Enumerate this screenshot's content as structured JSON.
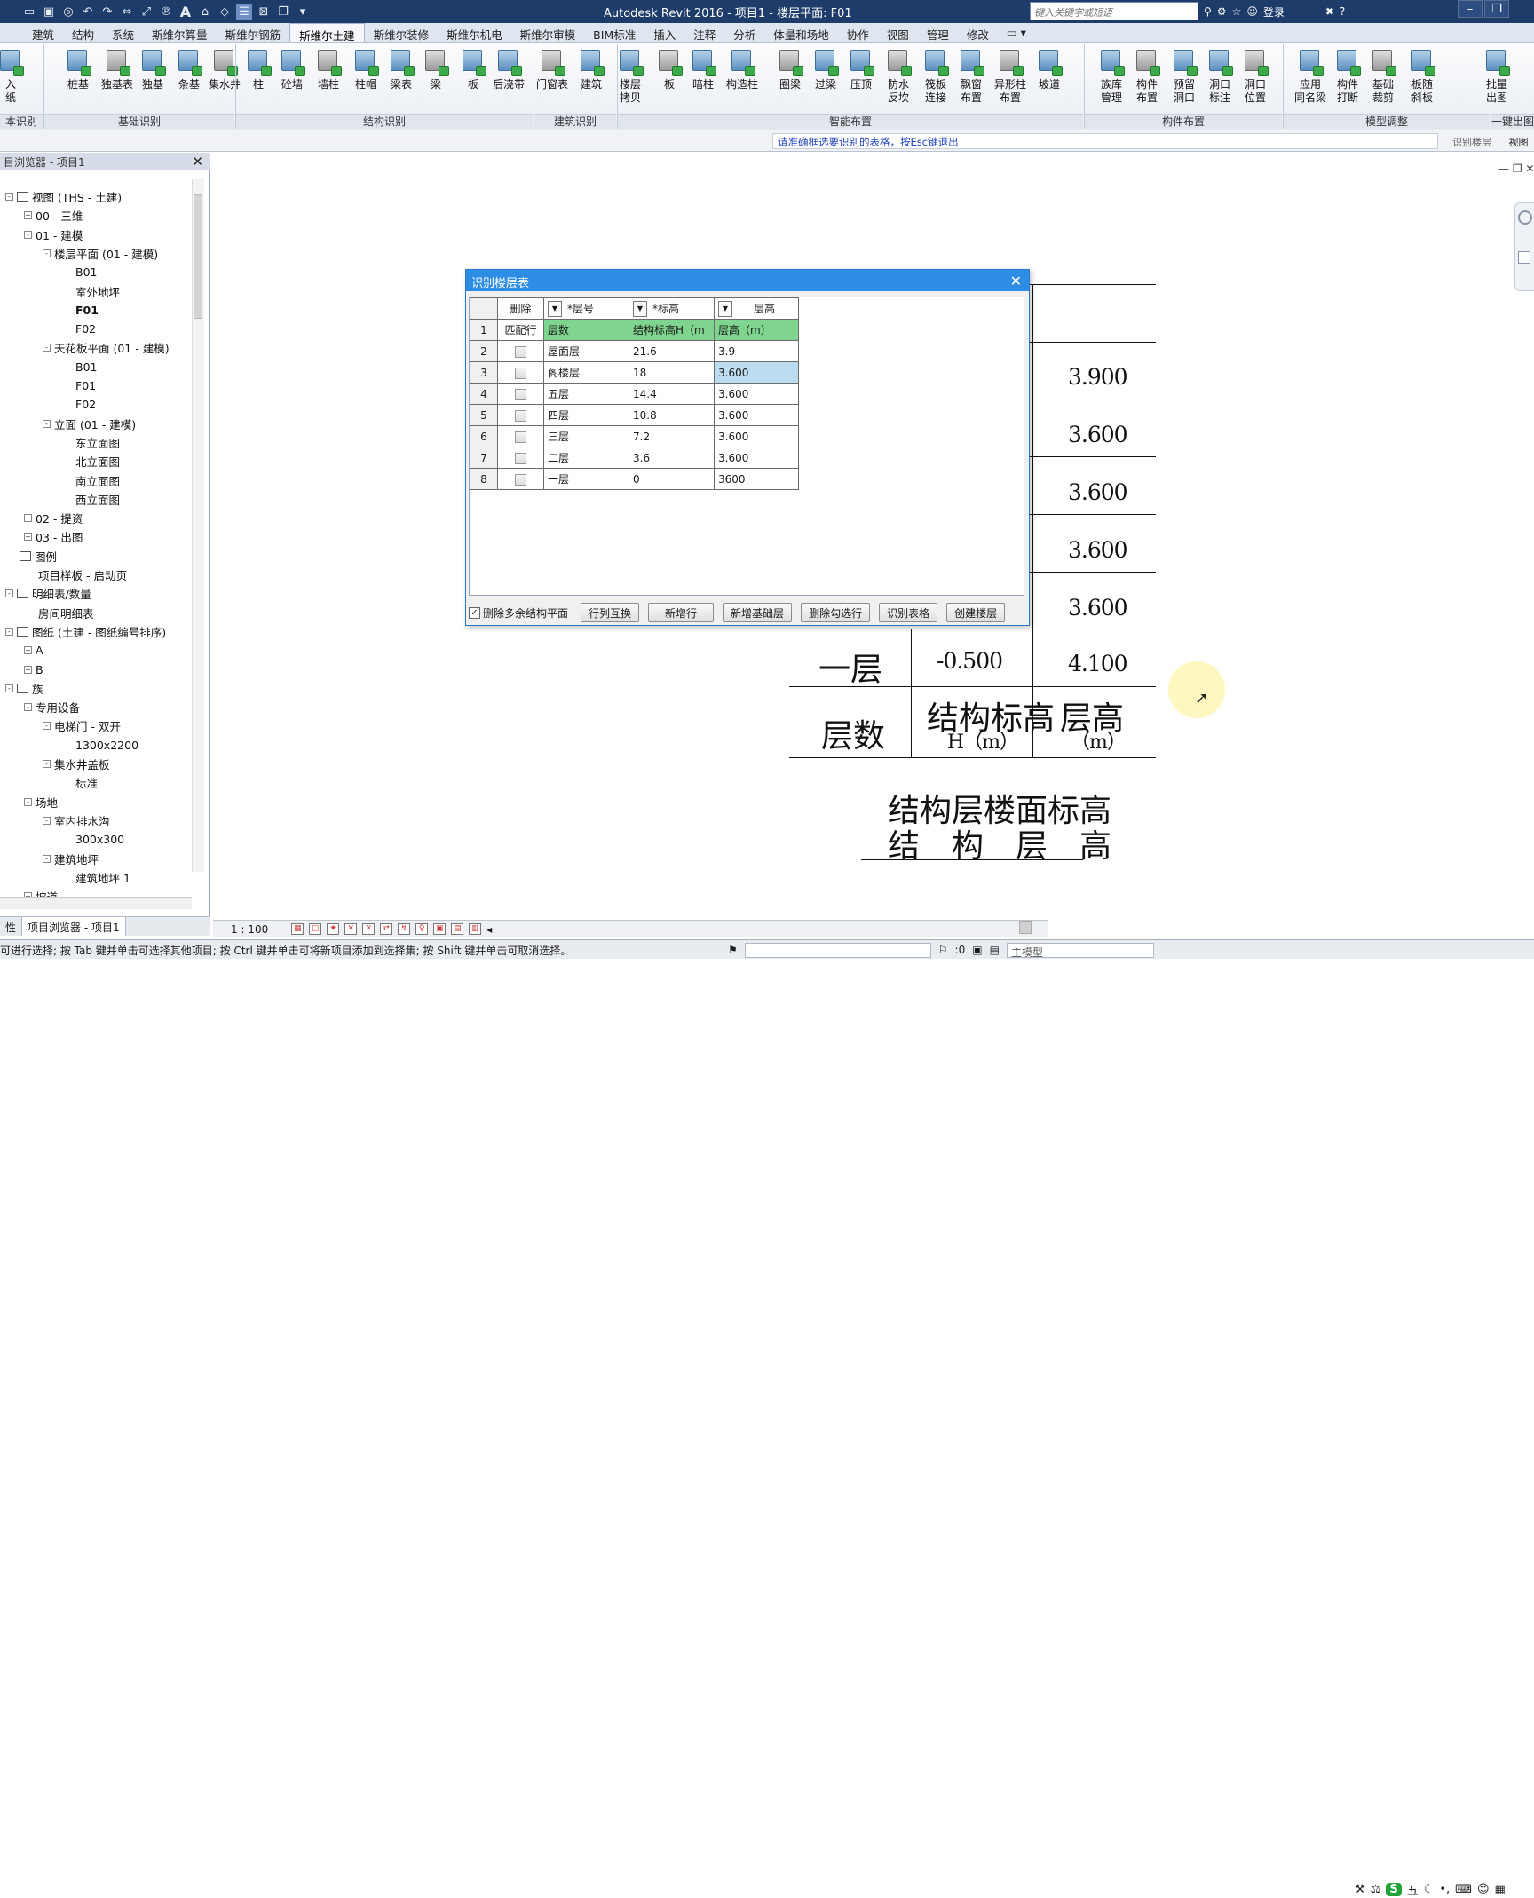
{
  "app": {
    "title": "Autodesk Revit 2016 -    项目1 - 楼层平面: F01",
    "search_placeholder": "键入关键字或短语",
    "login": "登录"
  },
  "tabs": [
    "建筑",
    "结构",
    "系统",
    "斯维尔算量",
    "斯维尔钢筋",
    "斯维尔土建",
    "斯维尔装修",
    "斯维尔机电",
    "斯维尔审模",
    "BIM标准",
    "插入",
    "注释",
    "分析",
    "体量和场地",
    "协作",
    "视图",
    "管理",
    "修改"
  ],
  "active_tab": "斯维尔土建",
  "ribbon": {
    "buttons": [
      {
        "label": "入\n纸",
        "icon": "import-drawing-icon"
      },
      {
        "label": "桩基",
        "icon": "pile-icon"
      },
      {
        "label": "独基表",
        "icon": "isolated-footing-table-icon"
      },
      {
        "label": "独基",
        "icon": "isolated-footing-icon"
      },
      {
        "label": "条基",
        "icon": "strip-footing-icon"
      },
      {
        "label": "集水井",
        "icon": "sump-pit-icon"
      },
      {
        "label": "柱",
        "icon": "column-icon"
      },
      {
        "label": "砼墙",
        "icon": "concrete-wall-icon"
      },
      {
        "label": "墙柱",
        "icon": "wall-column-icon"
      },
      {
        "label": "柱帽",
        "icon": "column-cap-icon"
      },
      {
        "label": "梁表",
        "icon": "beam-table-icon"
      },
      {
        "label": "梁",
        "icon": "beam-icon"
      },
      {
        "label": "板",
        "icon": "slab-icon"
      },
      {
        "label": "后浇带",
        "icon": "post-cast-strip-icon"
      },
      {
        "label": "门窗表",
        "icon": "door-window-table-icon"
      },
      {
        "label": "建筑",
        "icon": "architecture-icon"
      },
      {
        "label": "楼层\n拷贝",
        "icon": "floor-copy-icon"
      },
      {
        "label": "板",
        "icon": "slab-layout-icon"
      },
      {
        "label": "暗柱",
        "icon": "hidden-column-icon"
      },
      {
        "label": "构造柱",
        "icon": "constructional-column-icon"
      },
      {
        "label": "圈梁",
        "icon": "ring-beam-icon"
      },
      {
        "label": "过梁",
        "icon": "lintel-icon"
      },
      {
        "label": "压顶",
        "icon": "coping-icon"
      },
      {
        "label": "防水\n反坎",
        "icon": "waterproof-curb-icon"
      },
      {
        "label": "筏板\n连接",
        "icon": "raft-connect-icon"
      },
      {
        "label": "飘窗\n布置",
        "icon": "bay-window-icon"
      },
      {
        "label": "异形柱\n布置",
        "icon": "special-column-icon"
      },
      {
        "label": "坡道",
        "icon": "ramp-icon"
      },
      {
        "label": "族库\n管理",
        "icon": "family-library-icon"
      },
      {
        "label": "构件\n布置",
        "icon": "component-layout-icon"
      },
      {
        "label": "预留\n洞口",
        "icon": "reserved-opening-icon"
      },
      {
        "label": "洞口\n标注",
        "icon": "opening-tag-icon"
      },
      {
        "label": "洞口\n位置",
        "icon": "opening-position-icon"
      },
      {
        "label": "应用\n同名梁",
        "icon": "apply-same-beam-icon"
      },
      {
        "label": "构件\n打断",
        "icon": "break-component-icon"
      },
      {
        "label": "基础\n裁剪",
        "icon": "trim-foundation-icon"
      },
      {
        "label": "板随\n斜板",
        "icon": "slab-follow-slope-icon"
      },
      {
        "label": "批量\n出图",
        "icon": "batch-output-icon"
      }
    ],
    "groups": [
      "本识别",
      "基础识别",
      "结构识别",
      "建筑识别",
      "智能布置",
      "构件布置",
      "模型调整",
      "一键出图"
    ]
  },
  "options_bar": {
    "prompt": "请准确框选要识别的表格，按Esc键退出",
    "right_a": "识别楼层",
    "right_b": "视图"
  },
  "project_browser": {
    "title": "目浏览器 - 项目1",
    "tree": [
      {
        "label": "视图 (THS - 土建)",
        "level": 0,
        "exp": "-",
        "icon": true
      },
      {
        "label": "00 - 三维",
        "level": 1,
        "exp": "+"
      },
      {
        "label": "01 - 建模",
        "level": 1,
        "exp": "-"
      },
      {
        "label": "楼层平面 (01 - 建模)",
        "level": 2,
        "exp": "-"
      },
      {
        "label": "B01",
        "level": 3
      },
      {
        "label": "室外地坪",
        "level": 3
      },
      {
        "label": "F01",
        "level": 3,
        "bold": true
      },
      {
        "label": "F02",
        "level": 3
      },
      {
        "label": "天花板平面 (01 - 建模)",
        "level": 2,
        "exp": "-"
      },
      {
        "label": "B01",
        "level": 3
      },
      {
        "label": "F01",
        "level": 3
      },
      {
        "label": "F02",
        "level": 3
      },
      {
        "label": "立面 (01 - 建模)",
        "level": 2,
        "exp": "-"
      },
      {
        "label": "东立面图",
        "level": 3
      },
      {
        "label": "北立面图",
        "level": 3
      },
      {
        "label": "南立面图",
        "level": 3
      },
      {
        "label": "西立面图",
        "level": 3
      },
      {
        "label": "02 - 提资",
        "level": 1,
        "exp": "+"
      },
      {
        "label": "03 - 出图",
        "level": 1,
        "exp": "+"
      },
      {
        "label": "图例",
        "level": 0,
        "icon": true
      },
      {
        "label": "项目样板 - 启动页",
        "level": 1
      },
      {
        "label": "明细表/数量",
        "level": 0,
        "exp": "-",
        "icon": true
      },
      {
        "label": "房间明细表",
        "level": 1
      },
      {
        "label": "图纸 (土建 - 图纸编号排序)",
        "level": 0,
        "exp": "-",
        "icon": true
      },
      {
        "label": "A",
        "level": 1,
        "exp": "+"
      },
      {
        "label": "B",
        "level": 1,
        "exp": "+"
      },
      {
        "label": "族",
        "level": 0,
        "exp": "-",
        "icon": true
      },
      {
        "label": "专用设备",
        "level": 1,
        "exp": "-"
      },
      {
        "label": "电梯门 - 双开",
        "level": 2,
        "exp": "-"
      },
      {
        "label": "1300x2200",
        "level": 3
      },
      {
        "label": "集水井盖板",
        "level": 2,
        "exp": "-"
      },
      {
        "label": "标准",
        "level": 3
      },
      {
        "label": "场地",
        "level": 1,
        "exp": "-"
      },
      {
        "label": "室内排水沟",
        "level": 2,
        "exp": "-"
      },
      {
        "label": "300x300",
        "level": 3
      },
      {
        "label": "建筑地坪",
        "level": 2,
        "exp": "-"
      },
      {
        "label": "建筑地坪 1",
        "level": 3
      },
      {
        "label": "坡道",
        "level": 1,
        "exp": "+"
      }
    ],
    "bottom_tabs": [
      "性",
      "项目浏览器 - 项目1"
    ]
  },
  "dialog": {
    "title": "识别楼层表",
    "header": {
      "del": "删除",
      "col1": "*层号",
      "col2": "*标高",
      "col3": "层高"
    },
    "row1": {
      "num": "1",
      "del": "匹配行",
      "col1": "层数",
      "col2": "结构标高H（m",
      "col3": "层高（m）"
    },
    "rows": [
      {
        "num": "2",
        "c1": "屋面层",
        "c2": "21.6",
        "c3": "3.9"
      },
      {
        "num": "3",
        "c1": "阁楼层",
        "c2": "18",
        "c3": "3.600"
      },
      {
        "num": "4",
        "c1": "五层",
        "c2": "14.4",
        "c3": "3.600"
      },
      {
        "num": "5",
        "c1": "四层",
        "c2": "10.8",
        "c3": "3.600"
      },
      {
        "num": "6",
        "c1": "三层",
        "c2": "7.2",
        "c3": "3.600"
      },
      {
        "num": "7",
        "c1": "二层",
        "c2": "3.6",
        "c3": "3.600"
      },
      {
        "num": "8",
        "c1": "一层",
        "c2": "0",
        "c3": "3600"
      }
    ],
    "checkbox_label": "删除多余结构平面",
    "buttons": [
      "行列互换",
      "新增行",
      "新增基础层",
      "删除勾选行",
      "识别表格",
      "创建楼层"
    ]
  },
  "drawing": {
    "heights": [
      "3.900",
      "3.600",
      "3.600",
      "3.600",
      "3.600"
    ],
    "floor1": {
      "name": "一层",
      "elev": "-0.500",
      "height": "4.100"
    },
    "header": {
      "c1": "层数",
      "c2a": "结构标高",
      "c2b": "H（m）",
      "c3a": "层高",
      "c3b": "（m）"
    },
    "title1": "结构层楼面标高",
    "title2": "结　构　层　高"
  },
  "view_control": {
    "scale": "1 : 100"
  },
  "status": {
    "text": "可进行选择; 按 Tab 键并单击可选择其他项目; 按 Ctrl 键并单击可将新项目添加到选择集; 按 Shift 键并单击可取消选择。",
    "coord": ":0",
    "model": "主模型",
    "tray": "五"
  }
}
